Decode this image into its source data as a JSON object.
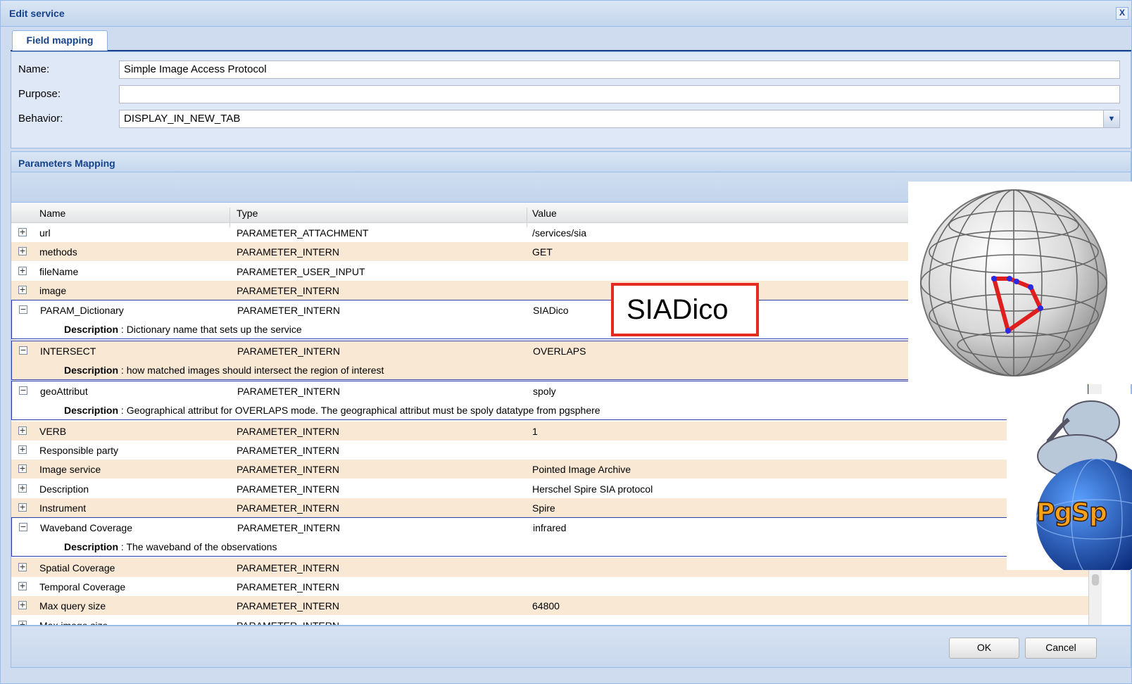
{
  "window": {
    "title": "Edit service",
    "close_glyph": "X"
  },
  "tabs": [
    {
      "label": "Field mapping"
    }
  ],
  "form": {
    "name_label": "Name:",
    "name_value": "Simple Image Access Protocol",
    "purpose_label": "Purpose:",
    "purpose_value": "",
    "behavior_label": "Behavior:",
    "behavior_value": "DISPLAY_IN_NEW_TAB"
  },
  "params": {
    "title": "Parameters Mapping",
    "columns": [
      "Name",
      "Type",
      "Value"
    ],
    "desc_label": "Description",
    "rows": [
      {
        "name": "url",
        "type": "PARAMETER_ATTACHMENT",
        "value": "/services/sia"
      },
      {
        "name": "methods",
        "type": "PARAMETER_INTERN",
        "value": "GET"
      },
      {
        "name": "fileName",
        "type": "PARAMETER_USER_INPUT",
        "value": ""
      },
      {
        "name": "image",
        "type": "PARAMETER_INTERN",
        "value": ""
      },
      {
        "name": "PARAM_Dictionary",
        "type": "PARAMETER_INTERN",
        "value": "SIADico",
        "description": "Dictionary name that sets up the service"
      },
      {
        "name": "INTERSECT",
        "type": "PARAMETER_INTERN",
        "value": "OVERLAPS",
        "description": "how matched images should intersect the region of interest"
      },
      {
        "name": "geoAttribut",
        "type": "PARAMETER_INTERN",
        "value": "spoly",
        "description": "Geographical attribut for OVERLAPS mode. The geographical attribut must be spoly datatype from pgsphere"
      },
      {
        "name": "VERB",
        "type": "PARAMETER_INTERN",
        "value": "1"
      },
      {
        "name": "Responsible party",
        "type": "PARAMETER_INTERN",
        "value": ""
      },
      {
        "name": "Image service",
        "type": "PARAMETER_INTERN",
        "value": "Pointed Image Archive"
      },
      {
        "name": "Description",
        "type": "PARAMETER_INTERN",
        "value": "Herschel Spire SIA protocol"
      },
      {
        "name": "Instrument",
        "type": "PARAMETER_INTERN",
        "value": "Spire"
      },
      {
        "name": "Waveband Coverage",
        "type": "PARAMETER_INTERN",
        "value": "infrared",
        "description": "The waveband of the observations"
      },
      {
        "name": "Spatial Coverage",
        "type": "PARAMETER_INTERN",
        "value": ""
      },
      {
        "name": "Temporal Coverage",
        "type": "PARAMETER_INTERN",
        "value": ""
      },
      {
        "name": "Max query size",
        "type": "PARAMETER_INTERN",
        "value": "64800"
      },
      {
        "name": "Max image size",
        "type": "PARAMETER_INTERN",
        "value": ""
      }
    ]
  },
  "buttons": {
    "ok": "OK",
    "cancel": "Cancel"
  },
  "overlays": {
    "callout": "SIADico",
    "logo_text": "PgSp"
  },
  "colors": {
    "header_text": "#15428b",
    "alt_row": "#f8e8d4",
    "expanded_border": "#2c3ca8",
    "callout_border": "#e52b1f"
  }
}
